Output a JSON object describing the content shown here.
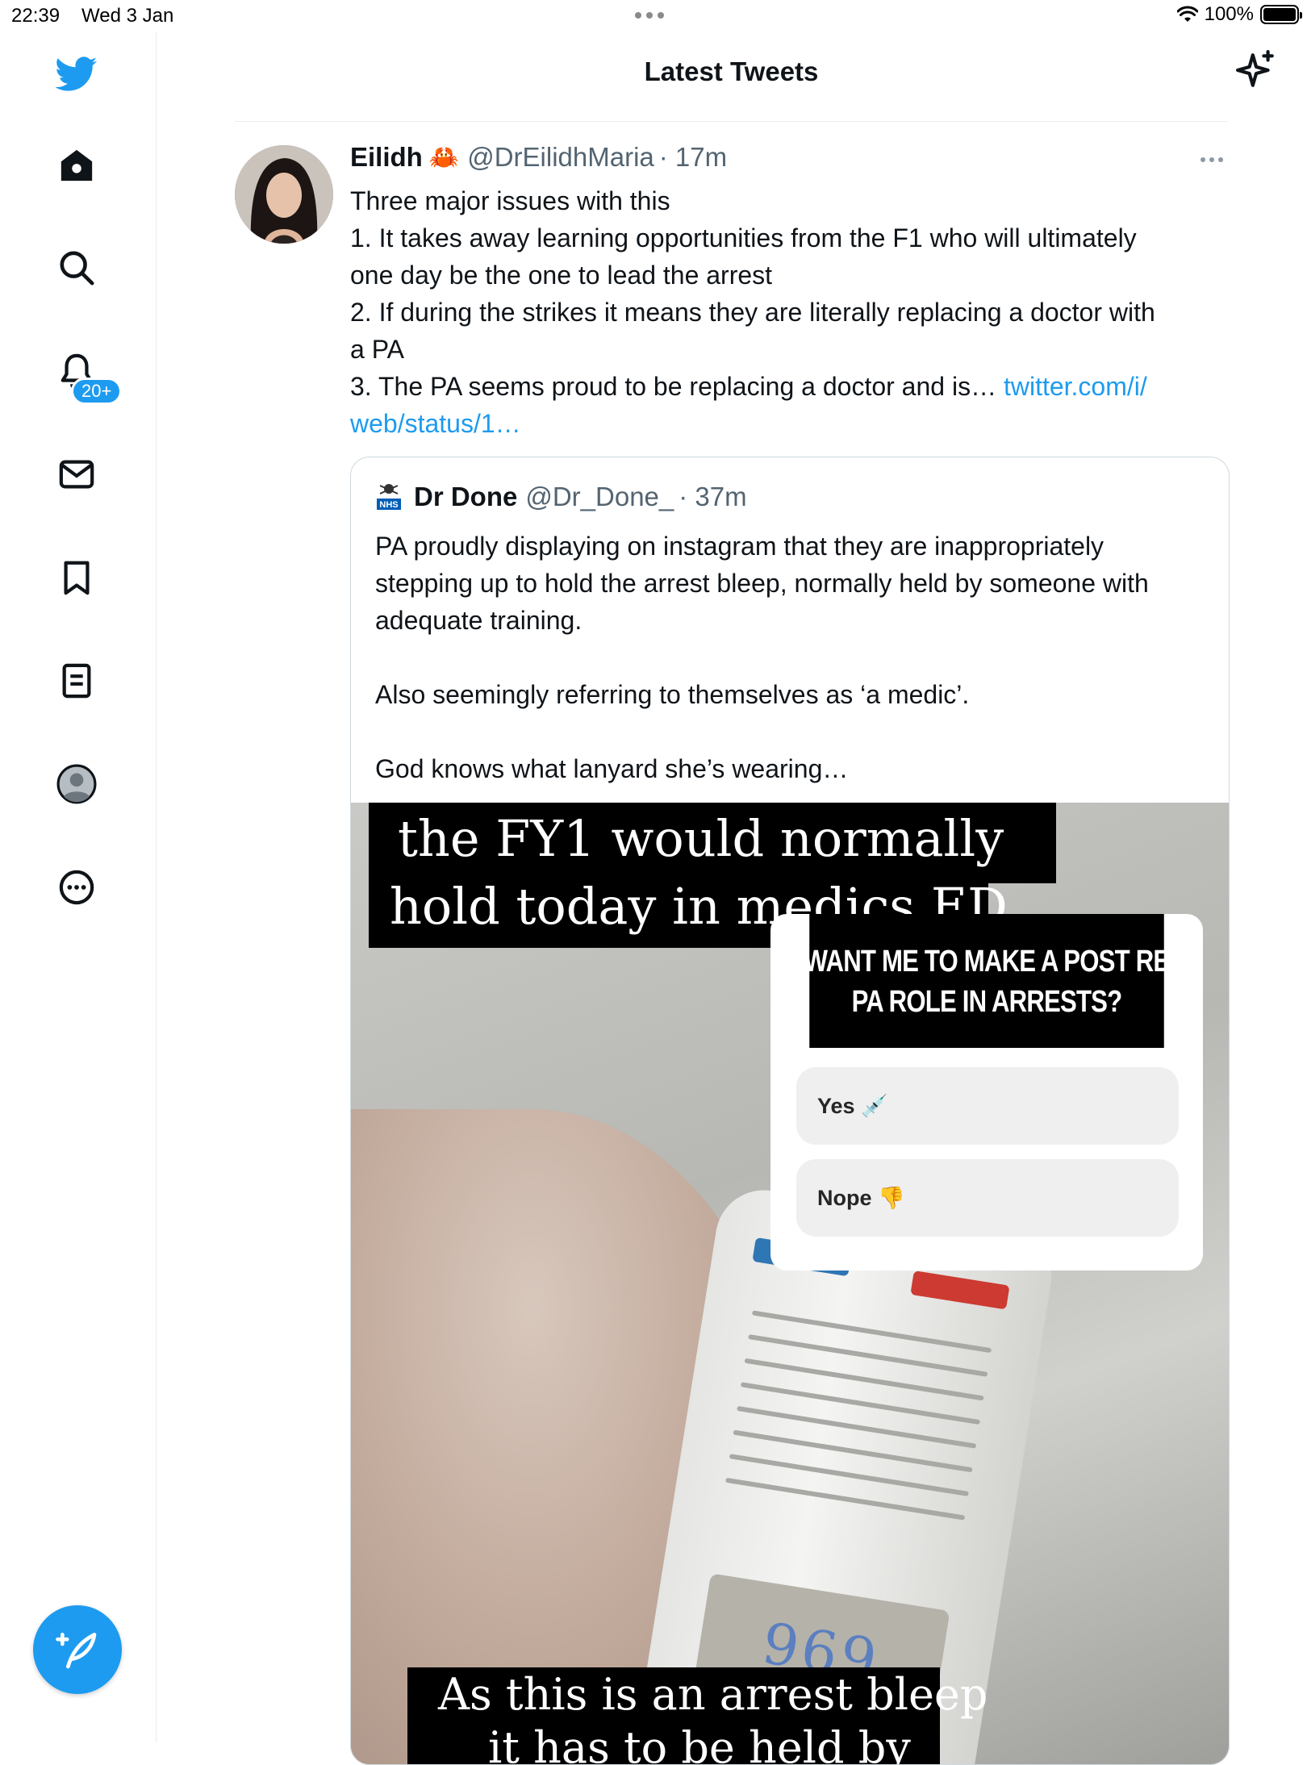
{
  "status_bar": {
    "time": "22:39",
    "date": "Wed 3 Jan",
    "battery": "100%"
  },
  "header": {
    "title": "Latest Tweets"
  },
  "sidebar": {
    "notifications_badge": "20+",
    "items": [
      "home-icon",
      "search-icon",
      "bell-icon",
      "mail-icon",
      "bookmark-icon",
      "lists-icon",
      "profile-icon",
      "more-icon"
    ]
  },
  "tweet": {
    "name": "Eilidh",
    "name_emoji": "🦀",
    "handle": "@DrEilidhMaria",
    "time": "· 17m",
    "lines": [
      "Three major issues with this",
      "1. It takes away learning opportunities from the F1 who will ultimately",
      "one day be the one to lead the arrest",
      "2. If during the strikes it means they are literally replacing a doctor with",
      "a PA",
      "3. The PA seems proud to be replacing a doctor and is… "
    ],
    "link_part1": "twitter.com/i/",
    "link_part2": "web/status/1…"
  },
  "quote": {
    "name": "Dr Done",
    "handle": "@Dr_Done_",
    "time": "· 37m",
    "lines": [
      "PA proudly displaying on instagram that they are inappropriately",
      "stepping up to hold the arrest bleep, normally held by someone with",
      "adequate training.",
      "",
      "Also seemingly referring to themselves as ‘a medic’.",
      "",
      "God knows what lanyard she’s wearing…"
    ]
  },
  "media": {
    "caption_line1": "the FY1 would normally",
    "caption_line2": "hold today in medics ED",
    "poll_question_line1": "WANT ME TO MAKE A POST RE",
    "poll_question_line2": "PA ROLE IN ARRESTS?",
    "poll_option_yes": "Yes 💉",
    "poll_option_no": "Nope 👎",
    "pager_number": "969",
    "bottom_caption": "As this is an arrest bleep",
    "bottom_caption_cut": "it has to be held by"
  },
  "colors": {
    "accent": "#1d9bf0",
    "text": "#0f1419",
    "secondary": "#536471"
  }
}
